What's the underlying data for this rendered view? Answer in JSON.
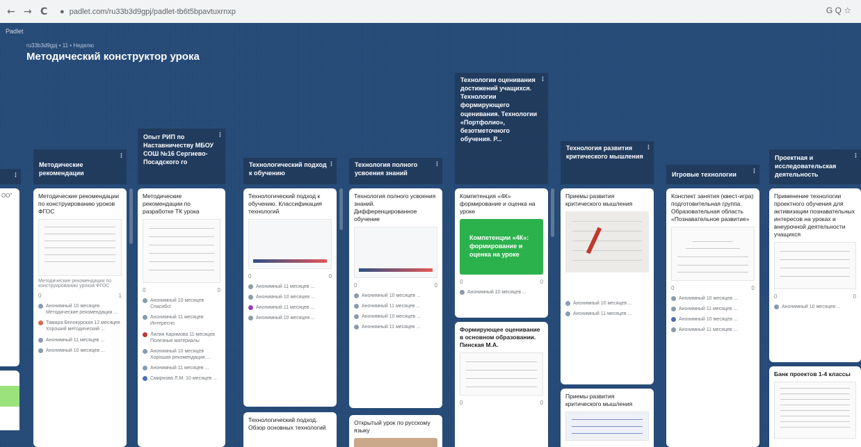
{
  "browser": {
    "back": "←",
    "forward": "→",
    "reload": "C",
    "url": "padlet.com/ru33b3d9gpj/padlet-tb6t5bpavtuxrnxp",
    "right_icons": "G  Q  ☆"
  },
  "board": {
    "logo": "Padlet",
    "breadcrumb": "ru33b3d9gpj • 11 • Неделю",
    "title": "Методический конструктор урока",
    "bg_color": "#264b78"
  },
  "columns": [
    {
      "title": "Методические рекомендации",
      "cards": [
        {
          "title": "Методические рекомендации по конструированию уроков ФГОС",
          "meta": "Методические рекомендации по конструированию уроков ФГОС",
          "likes": "0",
          "comments": "1",
          "items": [
            "Анонимный 10 месяцев Методические рекомендации ...",
            "Тамара Белокурская 12 месяцев Хороший методический ...",
            "Анонимный 11 месяцев ...",
            "Анонимный 10 месяцев ..."
          ]
        }
      ]
    },
    {
      "title": "Опыт РИП по Наставничеству МБОУ СОШ №16 Сергиево-Посадского го",
      "cards": [
        {
          "title": "Методические рекомендации по разработке ТК урока",
          "meta": "",
          "likes": "0",
          "comments": "0",
          "items": [
            "Анонимный 10 месяцев Спасибо!",
            "Анонимный 11 месяцев Интересно",
            "Лилия Каримова 11 месяцев Полезные материалы",
            "Анонимный 10 месяцев Хорошая рекомендация ...",
            "Анонимный 11 месяцев ...",
            "Смирнова Л.М. 10 месяцев ..."
          ]
        }
      ]
    },
    {
      "title": "Технологический подход к обучению",
      "cards": [
        {
          "title": "Технологический подход к обучению. Классификация технологий",
          "meta": "",
          "likes": "0",
          "comments": "0",
          "items": [
            "Анонимный 11 месяцев ...",
            "Анонимный 10 месяцев ...",
            "Анонимный 11 месяцев ...",
            "Анонимный 10 месяцев ..."
          ]
        },
        {
          "title": "Технологический подход. Обзор основных технологий",
          "meta": "",
          "likes": "",
          "comments": "",
          "items": []
        }
      ]
    },
    {
      "title": "Технология полного усвоения знаний",
      "cards": [
        {
          "title": "Технология полного усвоения знаний. Дифференцированное обучение",
          "meta": "",
          "likes": "0",
          "comments": "0",
          "items": [
            "Анонимный 10 месяцев ...",
            "Анонимный 11 месяцев ...",
            "Анонимный 10 месяцев ...",
            "Анонимный 11 месяцев ..."
          ]
        },
        {
          "title": "Открытый урок по русскому языку",
          "meta": "",
          "likes": "",
          "comments": "",
          "items": []
        }
      ]
    },
    {
      "title": "Технологии оценивания достижений учащихся. Технологии формирующего оценивания. Технологии «Портфолио», безотметочного обучения. Р...",
      "cards": [
        {
          "title": "Компетенция «4К» формирование и оценка на уроке",
          "image_text": "Компетенции «4К»: формирование и оценка на уроке",
          "meta": "",
          "likes": "0",
          "comments": "0",
          "items": [
            "Анонимный 10 месяцев ..."
          ]
        },
        {
          "title": "Формирующее оценивание в основном образовании. Пинская М.А.",
          "meta": "",
          "likes": "0",
          "comments": "0",
          "items": []
        }
      ]
    },
    {
      "title": "Технология развития критического мышления",
      "cards": [
        {
          "title": "Приемы развития критического мышления",
          "meta": "",
          "likes": "",
          "comments": "",
          "items": [
            "Анонимный 10 месяцев ...",
            "Анонимный 11 месяцев ..."
          ]
        },
        {
          "title": "Приемы развития критического мышления",
          "meta": "",
          "likes": "",
          "comments": "",
          "items": []
        }
      ]
    },
    {
      "title": "Игровые технологии",
      "cards": [
        {
          "title": "Конспект занятия (квест-игра) подготовительная группа. Образовательная область «Познавательное развитие»",
          "meta": "",
          "likes": "0",
          "comments": "0",
          "items": [
            "Анонимный 10 месяцев ...",
            "Анонимный 11 месяцев ...",
            "Анонимный 10 месяцев ...",
            "Анонимный 11 месяцев ..."
          ]
        }
      ]
    },
    {
      "title": "Проектная и исследовательская деятельность",
      "cards": [
        {
          "title": "Применение технологии проектного обучения для активизации познавательных интересов на уроках и внеурочной деятельности учащихся",
          "meta": "",
          "likes": "0",
          "comments": "0",
          "items": [
            "Анонимный 10 месяцев ..."
          ]
        },
        {
          "title": "Банк проектов 1-4 классы",
          "meta": "",
          "likes": "",
          "comments": "",
          "items": []
        }
      ]
    }
  ]
}
